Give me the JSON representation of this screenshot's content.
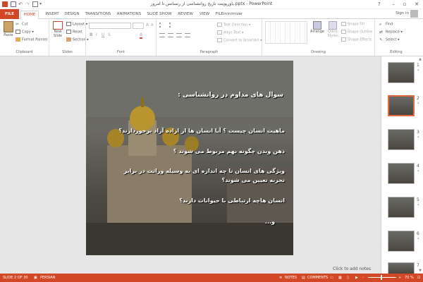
{
  "window": {
    "title": "پاورپوینت تاریخ روانشناسی از رنسانس تا امروز.pptx - PowerPoint",
    "help": "?",
    "minimize": "–",
    "restore": "▫",
    "close": "✕"
  },
  "tabs": [
    "FILE",
    "HOME",
    "INSERT",
    "DESIGN",
    "TRANSITIONS",
    "ANIMATIONS",
    "SLIDE SHOW",
    "REVIEW",
    "VIEW",
    "FILEminimizer"
  ],
  "account": {
    "signin": "Sign in"
  },
  "ribbon": {
    "clipboard": {
      "paste": "Paste",
      "cut": "Cut",
      "copy": "Copy",
      "format_painter": "Format Painter",
      "label": "Clipboard"
    },
    "slides": {
      "new_slide": "New",
      "new_slide2": "Slide",
      "layout": "Layout",
      "reset": "Reset",
      "section": "Section",
      "label": "Slides"
    },
    "font": {
      "label": "Font"
    },
    "paragraph": {
      "text_direction": "Text Direction",
      "align_text": "Align Text",
      "convert": "Convert to SmartArt",
      "label": "Paragraph"
    },
    "drawing": {
      "arrange": "Arrange",
      "quick_styles": "Quick",
      "quick_styles2": "Styles",
      "shape_fill": "Shape Fill",
      "shape_outline": "Shape Outline",
      "shape_effects": "Shape Effects",
      "label": "Drawing"
    },
    "editing": {
      "find": "Find",
      "replace": "Replace",
      "select": "Select",
      "label": "Editing"
    }
  },
  "slide": {
    "heading": "سوال های مداوم در روانشناسی :",
    "lines": [
      "ماهیت انسان چیست ؟ آیا انسان ها از اراده آزاد برخوردارند؟",
      "ذهن وبدن چگونه بهم مربوط می شوند ؟",
      "ویژگی های انسان تا چه اندازه ای به وسیله وراثت در برابر",
      "تجربه تعیین می شوند؟",
      "انسان هاچه ارتباطی با حیوانات دارند؟",
      "و..."
    ]
  },
  "notes_placeholder": "Click to add notes",
  "thumbnails": [
    {
      "num": "1",
      "star": "*"
    },
    {
      "num": "2",
      "star": "*"
    },
    {
      "num": "3",
      "star": "*"
    },
    {
      "num": "4",
      "star": "*"
    },
    {
      "num": "5",
      "star": "*"
    },
    {
      "num": "6",
      "star": "*"
    },
    {
      "num": "7",
      "star": ""
    }
  ],
  "status": {
    "slide_count": "SLIDE 2 OF 30",
    "language": "PERSIAN",
    "notes": "NOTES",
    "comments": "COMMENTS",
    "zoom": "70 %"
  },
  "colors": {
    "accent": "#d24726",
    "selected_thumb": "#e36b3d"
  }
}
